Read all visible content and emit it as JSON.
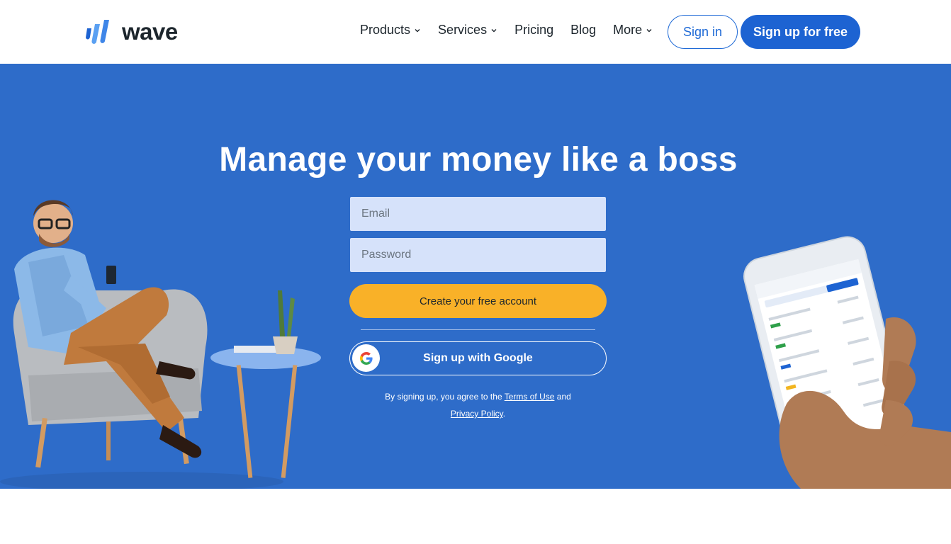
{
  "brand": {
    "name": "wave"
  },
  "nav": {
    "items": [
      {
        "label": "Products",
        "has_dropdown": true
      },
      {
        "label": "Services",
        "has_dropdown": true
      },
      {
        "label": "Pricing",
        "has_dropdown": false
      },
      {
        "label": "Blog",
        "has_dropdown": false
      },
      {
        "label": "More",
        "has_dropdown": true
      }
    ],
    "signin_label": "Sign in",
    "signup_label": "Sign up for free"
  },
  "hero": {
    "title": "Manage your money like a boss",
    "email_placeholder": "Email",
    "password_placeholder": "Password",
    "create_label": "Create your free account",
    "google_label": "Sign up with Google",
    "terms_prefix": "By signing up, you agree to the",
    "terms_link": "Terms of Use",
    "terms_and": "and",
    "privacy_link": "Privacy Policy",
    "terms_suffix": "."
  },
  "colors": {
    "hero_bg": "#2e6cc9",
    "primary": "#1d63d2",
    "cta_yellow": "#f9b128",
    "input_bg": "#d6e2fa"
  },
  "icons": {
    "chevron": "chevron-down-icon",
    "google": "google-g-icon",
    "logo": "wave-logo-icon"
  }
}
